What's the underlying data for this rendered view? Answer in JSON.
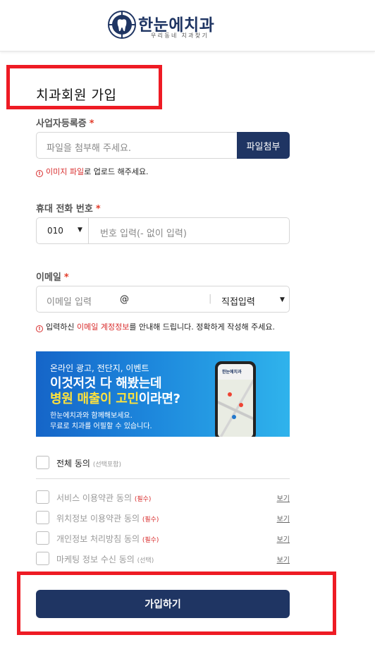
{
  "brand": {
    "name": "한눈에치과",
    "tagline": "우리동네 치과찾기"
  },
  "page": {
    "title": "치과회원 가입"
  },
  "business_license": {
    "label": "사업자등록증",
    "required_mark": "*",
    "placeholder": "파일을 첨부해 주세요.",
    "button": "파일첨부",
    "hint_icon": "!",
    "hint_highlight": "이미지 파일",
    "hint_rest": "로 업로드 해주세요."
  },
  "phone": {
    "label": "휴대 전화 번호",
    "required_mark": "*",
    "prefix": "010",
    "caret": "▼",
    "placeholder": "번호 입력(- 없이 입력)"
  },
  "email": {
    "label": "이메일",
    "required_mark": "*",
    "placeholder": "이메일 입력",
    "at": "@",
    "separator": "|",
    "domain_select": "직접입력",
    "caret": "▼",
    "hint_icon": "!",
    "hint_before": "입력하신 ",
    "hint_highlight": "이메일 계정정보",
    "hint_after": "를 안내해 드립니다. 정확하게 작성해 주세요."
  },
  "banner": {
    "line1": "온라인 광고, 전단지, 이벤트",
    "line2": "이것저것 다 해봤는데",
    "line3_highlight": "병원 매출이 고민",
    "line3_rest": "이라면?",
    "line4": "한눈에치과와 함께해보세요.",
    "line5": "무료로 치과를 어필할 수 있습니다.",
    "phone_logo": "한눈에치과"
  },
  "agreements": {
    "all": {
      "label": "전체 동의",
      "note": "(선택포함)"
    },
    "items": [
      {
        "label": "서비스 이용약관 동의",
        "tag": "(필수)",
        "view": "보기"
      },
      {
        "label": "위치정보 이용약관 동의",
        "tag": "(필수)",
        "view": "보기"
      },
      {
        "label": "개인정보 처리방침 동의",
        "tag": "(필수)",
        "view": "보기"
      },
      {
        "label": "마케팅 정보 수신 동의",
        "tag": "(선택)",
        "view": "보기"
      }
    ]
  },
  "submit": {
    "label": "가입하기"
  },
  "colors": {
    "navy": "#1f3563",
    "required": "#e23c2a",
    "highlight_red": "#d82c2c",
    "annotation_red": "#ee1b24"
  }
}
